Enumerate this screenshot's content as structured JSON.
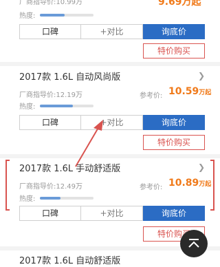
{
  "top_card": {
    "guide_label": "厂商指导价:",
    "guide_price": "10.99万",
    "ref_price": "9.69万起",
    "heat_label": "热度:",
    "heat_level": 0.46,
    "btn_koubei": "口碑",
    "btn_compare": "+对比",
    "btn_inquire": "询底价",
    "btn_special": "特价购买"
  },
  "card2": {
    "title": "2017款 1.6L 自动风尚版",
    "guide_label": "厂商指导价:",
    "guide_price": "12.19万",
    "ref_label": "参考价:",
    "ref_price_value": "10.59",
    "ref_price_unit": "万起",
    "heat_label": "热度:",
    "heat_level": 0.62,
    "btn_koubei": "口碑",
    "btn_compare": "+对比",
    "btn_inquire": "询底价",
    "btn_special": "特价购买"
  },
  "card3": {
    "title": "2017款 1.6L 手动舒适版",
    "guide_label": "厂商指导价:",
    "guide_price": "12.49万",
    "ref_label": "参考价:",
    "ref_price_value": "10.89",
    "ref_price_unit": "万起",
    "heat_label": "热度:",
    "heat_level": 0.38,
    "btn_koubei": "口碑",
    "btn_compare": "+对比",
    "btn_inquire": "询底价",
    "btn_special": "特价购买"
  },
  "card4": {
    "title": "2017款 1.6L 自动舒适版"
  },
  "colors": {
    "accent_blue": "#2b6cc4",
    "price_orange": "#f07a1a",
    "annotation_red": "#d9534f"
  },
  "icons": [
    "chevron-right-icon",
    "back-to-top-icon",
    "annotation-arrow"
  ]
}
